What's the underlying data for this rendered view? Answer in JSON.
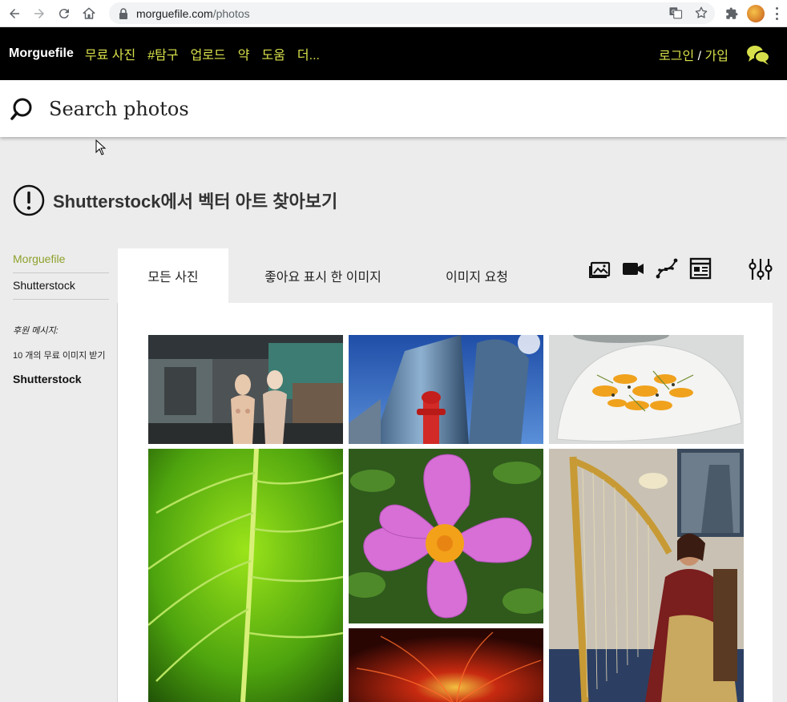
{
  "browser": {
    "url_host": "morguefile.com",
    "url_path": "/photos"
  },
  "header": {
    "brand": "Morguefile",
    "nav": [
      "무료 사진",
      "#탐구",
      "업로드",
      "약",
      "도움",
      "더..."
    ],
    "login": "로그인",
    "slash": "/",
    "signup": "가입"
  },
  "search": {
    "placeholder": "Search photos"
  },
  "promo": {
    "text": "Shutterstock에서 벡터 아트 찾아보기"
  },
  "sidebar": {
    "items": [
      "Morguefile",
      "Shutterstock"
    ],
    "sponsor_label": "후원 메시지:",
    "sponsor_free": "10 개의 무료 이미지 받기",
    "sponsor_brand": "Shutterstock"
  },
  "tabs": [
    {
      "label": "모든 사진"
    },
    {
      "label": "좋아요 표시 한 이미지"
    },
    {
      "label": "이미지 요청"
    }
  ],
  "photos": [
    {
      "subject": "mannequins storefront"
    },
    {
      "subject": "skyscraper with red hydrant"
    },
    {
      "subject": "orange salad on plate"
    },
    {
      "subject": "green leaf closeup"
    },
    {
      "subject": "pink flower"
    },
    {
      "subject": "woman playing harp"
    },
    {
      "subject": "red abstract light"
    }
  ],
  "colors": {
    "accent": "#d7e04a",
    "sidebar_active": "#8ea12b",
    "header_bg": "#000000",
    "page_bg": "#ececec"
  }
}
